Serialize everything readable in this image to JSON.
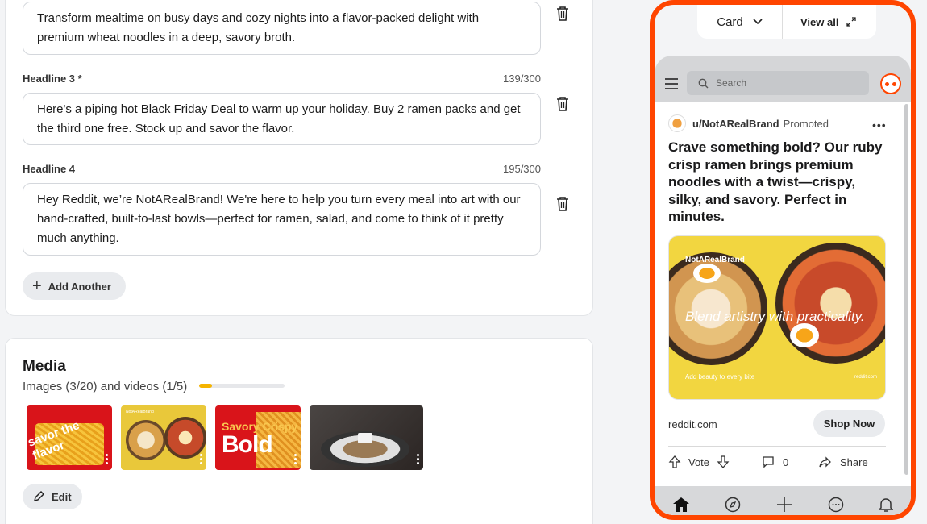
{
  "headlines": {
    "headline2_text": "Transform mealtime on busy days and cozy nights into a flavor-packed delight with premium wheat noodles in a deep, savory broth.",
    "headline3_label": "Headline 3 *",
    "headline3_count": "139/300",
    "headline3_text": "Here's a piping hot Black Friday Deal to warm up your holiday. Buy 2 ramen packs and get the third one free. Stock up and savor the flavor.",
    "headline4_label": "Headline 4",
    "headline4_count": "195/300",
    "headline4_text": "Hey Reddit, we’re NotARealBrand! We're here to help you turn every meal into art with our hand-crafted, built-to-last bowls—perfect for ramen, salad, and come to think of it pretty much anything.",
    "add_another_label": "Add Another"
  },
  "media": {
    "title": "Media",
    "subtitle": "Images (3/20) and videos (1/5)",
    "upload_progress": 0.15,
    "edit_label": "Edit",
    "thumbs": [
      {
        "text": "savor the flavor"
      },
      {
        "text": ""
      },
      {
        "text_top": "Savory Crispy",
        "text_big": "Bold"
      },
      {
        "text": ""
      }
    ],
    "thumb_small_brand": "NotARealBrand"
  },
  "preview": {
    "format_label": "Card",
    "view_all_label": "View all",
    "search_placeholder": "Search",
    "username": "u/NotARealBrand",
    "promoted": "Promoted",
    "headline": "Crave something bold? Our ruby crisp ramen brings premium noodles with a twist—crispy, silky, and savory. Perfect in minutes.",
    "image_brand": "NotARealBrand",
    "image_tagline": "Blend artistry with practicality.",
    "image_small": "Add beauty to every bite",
    "image_corner": "reddit.com",
    "domain": "reddit.com",
    "cta_label": "Shop Now",
    "vote_label": "Vote",
    "comment_count": "0",
    "share_label": "Share"
  },
  "colors": {
    "accent_orange": "#ff4500",
    "progress_yellow": "#f5b400"
  }
}
